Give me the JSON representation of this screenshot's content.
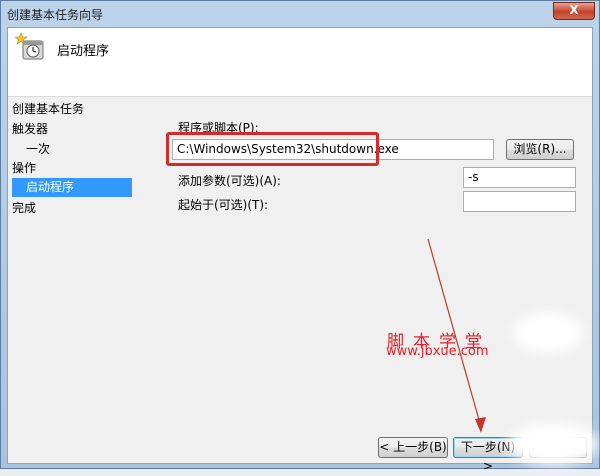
{
  "window": {
    "title": "创建基本任务向导",
    "close_label": "X"
  },
  "header": {
    "icon": "task-scheduler-icon",
    "title": "启动程序"
  },
  "nav": {
    "items": [
      {
        "label": "创建基本任务"
      },
      {
        "label": "触发器"
      },
      {
        "label": "一次"
      },
      {
        "label": "操作"
      },
      {
        "label": "启动程序"
      },
      {
        "label": "完成"
      }
    ]
  },
  "form": {
    "program_label": "程序或脚本(P):",
    "program_value": "C:\\Windows\\System32\\shutdown.exe",
    "browse_label": "浏览(R)...",
    "args_label": "添加参数(可选)(A):",
    "args_value": "-s",
    "startin_label": "起始于(可选)(T):",
    "startin_value": ""
  },
  "footer": {
    "back_label": "< 上一步(B)",
    "next_label": "下一步(N) >"
  },
  "watermark": {
    "line1": "脚本学堂",
    "line2": "www.jbxue.com"
  },
  "colors": {
    "highlight": "#d62a2a",
    "selection": "#3399ff",
    "annotation_arrow": "#c0392b"
  }
}
